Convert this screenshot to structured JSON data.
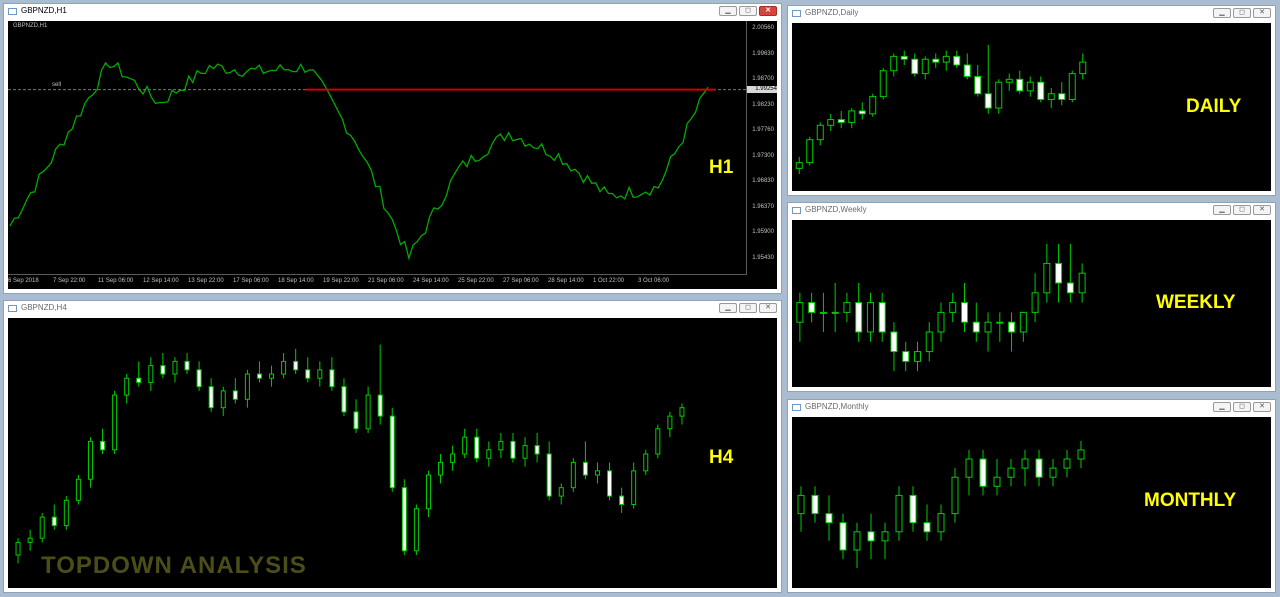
{
  "windows": {
    "h1": {
      "title": "GBPNZD,H1",
      "subtitle": "GBPNZD,H1",
      "tf_label": "H1",
      "sell_label": "sell",
      "current_price": "1.99254",
      "price_labels": [
        "2.00560",
        "1.99630",
        "1.98700",
        "1.98230",
        "1.97760",
        "1.97300",
        "1.96830",
        "1.96370",
        "1.95900",
        "1.95430"
      ],
      "time_labels": [
        "6 Sep 2018",
        "7 Sep 22:00",
        "11 Sep 06:00",
        "12 Sep 14:00",
        "13 Sep 22:00",
        "17 Sep 06:00",
        "18 Sep 14:00",
        "19 Sep 22:00",
        "21 Sep 06:00",
        "24 Sep 14:00",
        "25 Sep 22:00",
        "27 Sep 06:00",
        "28 Sep 14:00",
        "1 Oct 22:00",
        "3 Oct 06:00"
      ]
    },
    "h4": {
      "title": "GBPNZD,H4",
      "tf_label": "H4",
      "watermark": "TOPDOWN ANALYSIS"
    },
    "daily": {
      "title": "GBPNZD,Daily",
      "tf_label": "DAILY"
    },
    "weekly": {
      "title": "GBPNZD,Weekly",
      "tf_label": "WEEKLY"
    },
    "monthly": {
      "title": "GBPNZD,Monthly",
      "tf_label": "MONTHLY"
    }
  },
  "colors": {
    "candle_up": "#000000",
    "candle_down": "#ffffff",
    "wick": "#00cc00",
    "h1_line": "#00aa00",
    "sell_line": "#cc0000",
    "label": "#ffff00"
  },
  "chart_data": [
    {
      "type": "line",
      "name": "H1",
      "title": "GBPNZD,H1",
      "ylim": [
        1.9543,
        2.0065
      ],
      "x": [
        "6 Sep 2018",
        "7 Sep 22:00",
        "11 Sep 06:00",
        "12 Sep 14:00",
        "13 Sep 22:00",
        "17 Sep 06:00",
        "18 Sep 14:00",
        "19 Sep 22:00",
        "21 Sep 06:00",
        "24 Sep 14:00",
        "25 Sep 22:00",
        "27 Sep 06:00",
        "28 Sep 14:00",
        "1 Oct 22:00",
        "3 Oct 06:00"
      ],
      "values": [
        1.9625,
        1.98,
        1.9985,
        1.9895,
        1.9975,
        1.9965,
        1.9975,
        1.98,
        1.9555,
        1.975,
        1.983,
        1.978,
        1.969,
        1.971,
        1.993
      ],
      "sell_level": 1.9925
    },
    {
      "type": "candlestick",
      "name": "H4",
      "ylim": [
        1.954,
        2.007
      ],
      "ohlc": [
        [
          1.956,
          1.96,
          1.954,
          1.959
        ],
        [
          1.959,
          1.962,
          1.957,
          1.96
        ],
        [
          1.96,
          1.966,
          1.959,
          1.965
        ],
        [
          1.965,
          1.968,
          1.962,
          1.963
        ],
        [
          1.963,
          1.97,
          1.962,
          1.969
        ],
        [
          1.969,
          1.975,
          1.968,
          1.974
        ],
        [
          1.974,
          1.984,
          1.972,
          1.983
        ],
        [
          1.983,
          1.986,
          1.98,
          1.981
        ],
        [
          1.981,
          1.995,
          1.98,
          1.994
        ],
        [
          1.994,
          1.999,
          1.992,
          1.998
        ],
        [
          1.998,
          2.002,
          1.996,
          1.997
        ],
        [
          1.997,
          2.003,
          1.995,
          2.001
        ],
        [
          2.001,
          2.004,
          1.998,
          1.999
        ],
        [
          1.999,
          2.003,
          1.997,
          2.002
        ],
        [
          2.002,
          2.004,
          1.999,
          2.0
        ],
        [
          2.0,
          2.002,
          1.995,
          1.996
        ],
        [
          1.996,
          1.998,
          1.99,
          1.991
        ],
        [
          1.991,
          1.996,
          1.989,
          1.995
        ],
        [
          1.995,
          1.998,
          1.992,
          1.993
        ],
        [
          1.993,
          2.0,
          1.991,
          1.999
        ],
        [
          1.999,
          2.002,
          1.997,
          1.998
        ],
        [
          1.998,
          2.001,
          1.996,
          1.999
        ],
        [
          1.999,
          2.004,
          1.998,
          2.002
        ],
        [
          2.002,
          2.005,
          1.999,
          2.0
        ],
        [
          2.0,
          2.003,
          1.997,
          1.998
        ],
        [
          1.998,
          2.002,
          1.996,
          2.0
        ],
        [
          2.0,
          2.003,
          1.995,
          1.996
        ],
        [
          1.996,
          1.998,
          1.989,
          1.99
        ],
        [
          1.99,
          1.993,
          1.985,
          1.986
        ],
        [
          1.986,
          1.996,
          1.985,
          1.994
        ],
        [
          1.994,
          2.006,
          1.987,
          1.989
        ],
        [
          1.989,
          1.991,
          1.971,
          1.972
        ],
        [
          1.972,
          1.974,
          1.956,
          1.957
        ],
        [
          1.957,
          1.968,
          1.956,
          1.967
        ],
        [
          1.967,
          1.976,
          1.965,
          1.975
        ],
        [
          1.975,
          1.98,
          1.973,
          1.978
        ],
        [
          1.978,
          1.982,
          1.976,
          1.98
        ],
        [
          1.98,
          1.986,
          1.979,
          1.984
        ],
        [
          1.984,
          1.986,
          1.978,
          1.979
        ],
        [
          1.979,
          1.983,
          1.977,
          1.981
        ],
        [
          1.981,
          1.985,
          1.979,
          1.983
        ],
        [
          1.983,
          1.985,
          1.978,
          1.979
        ],
        [
          1.979,
          1.984,
          1.977,
          1.982
        ],
        [
          1.982,
          1.985,
          1.978,
          1.98
        ],
        [
          1.98,
          1.983,
          1.969,
          1.97
        ],
        [
          1.97,
          1.973,
          1.968,
          1.972
        ],
        [
          1.972,
          1.979,
          1.971,
          1.978
        ],
        [
          1.978,
          1.983,
          1.974,
          1.975
        ],
        [
          1.975,
          1.978,
          1.973,
          1.976
        ],
        [
          1.976,
          1.978,
          1.969,
          1.97
        ],
        [
          1.97,
          1.972,
          1.966,
          1.968
        ],
        [
          1.968,
          1.978,
          1.967,
          1.976
        ],
        [
          1.976,
          1.981,
          1.975,
          1.98
        ],
        [
          1.98,
          1.987,
          1.979,
          1.986
        ],
        [
          1.986,
          1.99,
          1.984,
          1.989
        ],
        [
          1.989,
          1.992,
          1.987,
          1.991
        ]
      ]
    },
    {
      "type": "candlestick",
      "name": "DAILY",
      "ohlc": [
        [
          1.947,
          1.951,
          1.945,
          1.949
        ],
        [
          1.949,
          1.958,
          1.948,
          1.957
        ],
        [
          1.957,
          1.963,
          1.955,
          1.962
        ],
        [
          1.962,
          1.966,
          1.96,
          1.964
        ],
        [
          1.964,
          1.967,
          1.961,
          1.963
        ],
        [
          1.963,
          1.968,
          1.961,
          1.967
        ],
        [
          1.967,
          1.97,
          1.964,
          1.966
        ],
        [
          1.966,
          1.973,
          1.965,
          1.972
        ],
        [
          1.972,
          1.982,
          1.971,
          1.981
        ],
        [
          1.981,
          1.987,
          1.979,
          1.986
        ],
        [
          1.986,
          1.988,
          1.983,
          1.985
        ],
        [
          1.985,
          1.987,
          1.979,
          1.98
        ],
        [
          1.98,
          1.986,
          1.978,
          1.985
        ],
        [
          1.985,
          1.987,
          1.982,
          1.984
        ],
        [
          1.984,
          1.988,
          1.981,
          1.986
        ],
        [
          1.986,
          1.988,
          1.982,
          1.983
        ],
        [
          1.983,
          1.987,
          1.978,
          1.979
        ],
        [
          1.979,
          1.983,
          1.972,
          1.973
        ],
        [
          1.973,
          1.99,
          1.966,
          1.968
        ],
        [
          1.968,
          1.978,
          1.966,
          1.977
        ],
        [
          1.977,
          1.98,
          1.974,
          1.978
        ],
        [
          1.978,
          1.981,
          1.973,
          1.974
        ],
        [
          1.974,
          1.979,
          1.972,
          1.977
        ],
        [
          1.977,
          1.979,
          1.97,
          1.971
        ],
        [
          1.971,
          1.975,
          1.968,
          1.973
        ],
        [
          1.973,
          1.977,
          1.969,
          1.971
        ],
        [
          1.971,
          1.981,
          1.97,
          1.98
        ],
        [
          1.98,
          1.987,
          1.978,
          1.984
        ]
      ]
    },
    {
      "type": "candlestick",
      "name": "WEEKLY",
      "ohlc": [
        [
          1.96,
          1.99,
          1.94,
          1.98
        ],
        [
          1.98,
          1.99,
          1.96,
          1.97
        ],
        [
          1.97,
          1.99,
          1.95,
          1.97
        ],
        [
          1.97,
          2.0,
          1.95,
          1.97
        ],
        [
          1.97,
          1.99,
          1.96,
          1.98
        ],
        [
          1.98,
          2.0,
          1.94,
          1.95
        ],
        [
          1.95,
          1.99,
          1.94,
          1.98
        ],
        [
          1.98,
          1.99,
          1.94,
          1.95
        ],
        [
          1.95,
          1.96,
          1.91,
          1.93
        ],
        [
          1.93,
          1.94,
          1.91,
          1.92
        ],
        [
          1.92,
          1.94,
          1.91,
          1.93
        ],
        [
          1.93,
          1.96,
          1.92,
          1.95
        ],
        [
          1.95,
          1.98,
          1.94,
          1.97
        ],
        [
          1.97,
          1.99,
          1.96,
          1.98
        ],
        [
          1.98,
          2.0,
          1.95,
          1.96
        ],
        [
          1.96,
          1.98,
          1.94,
          1.95
        ],
        [
          1.95,
          1.97,
          1.93,
          1.96
        ],
        [
          1.96,
          1.97,
          1.94,
          1.96
        ],
        [
          1.96,
          1.97,
          1.93,
          1.95
        ],
        [
          1.95,
          1.97,
          1.94,
          1.97
        ],
        [
          1.97,
          2.01,
          1.96,
          1.99
        ],
        [
          1.99,
          2.04,
          1.98,
          2.02
        ],
        [
          2.02,
          2.04,
          1.98,
          2.0
        ],
        [
          2.0,
          2.04,
          1.98,
          1.99
        ],
        [
          1.99,
          2.02,
          1.98,
          2.01
        ]
      ]
    },
    {
      "type": "candlestick",
      "name": "MONTHLY",
      "ohlc": [
        [
          1.96,
          1.99,
          1.94,
          1.98
        ],
        [
          1.98,
          1.99,
          1.95,
          1.96
        ],
        [
          1.96,
          1.98,
          1.93,
          1.95
        ],
        [
          1.95,
          1.96,
          1.91,
          1.92
        ],
        [
          1.92,
          1.95,
          1.9,
          1.94
        ],
        [
          1.94,
          1.96,
          1.91,
          1.93
        ],
        [
          1.93,
          1.95,
          1.91,
          1.94
        ],
        [
          1.94,
          1.99,
          1.93,
          1.98
        ],
        [
          1.98,
          1.99,
          1.94,
          1.95
        ],
        [
          1.95,
          1.97,
          1.93,
          1.94
        ],
        [
          1.94,
          1.97,
          1.93,
          1.96
        ],
        [
          1.96,
          2.01,
          1.95,
          2.0
        ],
        [
          2.0,
          2.03,
          1.98,
          2.02
        ],
        [
          2.02,
          2.03,
          1.98,
          1.99
        ],
        [
          1.99,
          2.02,
          1.98,
          2.0
        ],
        [
          2.0,
          2.02,
          1.99,
          2.01
        ],
        [
          2.01,
          2.03,
          1.99,
          2.02
        ],
        [
          2.02,
          2.03,
          1.99,
          2.0
        ],
        [
          2.0,
          2.02,
          1.99,
          2.01
        ],
        [
          2.01,
          2.03,
          2.0,
          2.02
        ],
        [
          2.02,
          2.04,
          2.01,
          2.03
        ]
      ]
    }
  ]
}
